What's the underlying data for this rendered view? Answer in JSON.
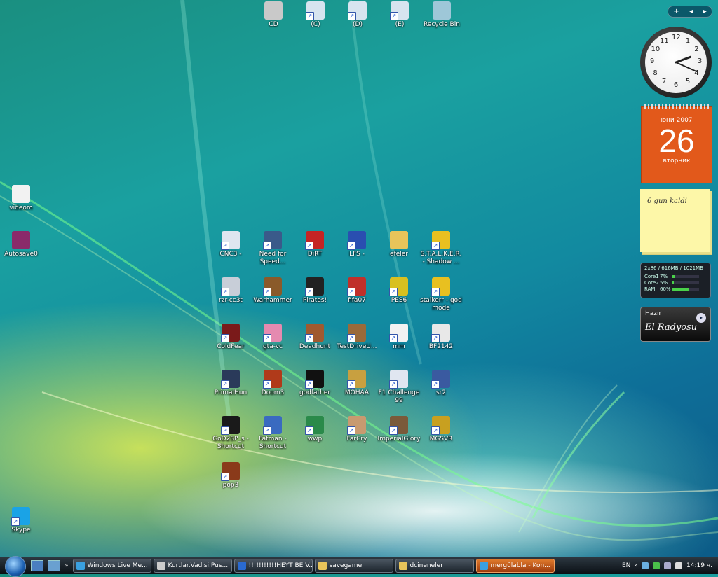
{
  "desktop": {
    "icons_top": [
      {
        "label": "CD",
        "icon": "cd-drive-icon",
        "color": "#c9c9c9"
      },
      {
        "label": "(C)",
        "icon": "drive-c-icon",
        "color": "#d7e4ef"
      },
      {
        "label": "(D)",
        "icon": "drive-d-icon",
        "color": "#d7e4ef"
      },
      {
        "label": "(E)",
        "icon": "drive-e-icon",
        "color": "#d7e4ef"
      },
      {
        "label": "Recycle Bin",
        "icon": "recycle-bin-icon",
        "color": "#9ec7d8"
      }
    ],
    "icons_left": [
      {
        "label": "videom",
        "icon": "video-file-icon",
        "color": "#f2f2f2"
      },
      {
        "label": "Autosave0",
        "icon": "winrar-archive-icon",
        "color": "#8a2a6a"
      },
      {
        "label": "Skype",
        "icon": "skype-icon",
        "color": "#1aa3e6"
      }
    ],
    "grid_rows": [
      [
        {
          "label": "CNC3 -",
          "icon": "cnc3-icon",
          "color": "#dfe6f0"
        },
        {
          "label": "Need for Speed...",
          "icon": "nfs-icon",
          "color": "#3a5a8a"
        },
        {
          "label": "DiRT",
          "icon": "dirt-icon",
          "color": "#c52424"
        },
        {
          "label": "LFS -",
          "icon": "lfs-icon",
          "color": "#2a4fb0"
        },
        {
          "label": "efeler",
          "icon": "folder-icon",
          "color": "#e8c45a"
        },
        {
          "label": "S.T.A.L.K.E.R. - Shadow ...",
          "icon": "stalker-icon",
          "color": "#e8c020"
        }
      ],
      [
        {
          "label": "rzr-cc3t",
          "icon": "rzr-icon",
          "color": "#c8ced8"
        },
        {
          "label": "Warhammer",
          "icon": "warhammer-icon",
          "color": "#8a5a2a"
        },
        {
          "label": "Pirates!",
          "icon": "pirates-icon",
          "color": "#222222"
        },
        {
          "label": "fifa07",
          "icon": "fifa-icon",
          "color": "#c0302a"
        },
        {
          "label": "PES6",
          "icon": "pes-icon",
          "color": "#d8c020"
        },
        {
          "label": "stalkerr - god mode",
          "icon": "stalker-icon",
          "color": "#e8c020"
        }
      ],
      [
        {
          "label": "ColdFear",
          "icon": "coldfear-icon",
          "color": "#7a1a1a"
        },
        {
          "label": "gta-vc",
          "icon": "gta-icon",
          "color": "#e58ab0"
        },
        {
          "label": "Deadhunt",
          "icon": "deadhunt-icon",
          "color": "#a05a30"
        },
        {
          "label": "TestDriveU...",
          "icon": "testdrive-icon",
          "color": "#9a6a3a"
        },
        {
          "label": "mm",
          "icon": "mm-icon",
          "color": "#f2f2f2"
        },
        {
          "label": "BF2142",
          "icon": "bf2142-icon",
          "color": "#e8e8e8"
        }
      ],
      [
        {
          "label": "PrimalHun",
          "icon": "primalhunt-icon",
          "color": "#2a3a5a"
        },
        {
          "label": "Doom3",
          "icon": "doom3-icon",
          "color": "#b03a1a"
        },
        {
          "label": "godfather",
          "icon": "godfather-icon",
          "color": "#111111"
        },
        {
          "label": "MOHAA",
          "icon": "mohaa-icon",
          "color": "#c8a040"
        },
        {
          "label": "F1 Challenge 99",
          "icon": "f1-icon",
          "color": "#e0e6f0"
        },
        {
          "label": "sr2",
          "icon": "sr2-icon",
          "color": "#3a5aa0"
        }
      ],
      [
        {
          "label": "GoD2SP_s - Shortcut",
          "icon": "godsp-icon",
          "color": "#1a1a1a"
        },
        {
          "label": "Fatman - Shortcut",
          "icon": "fatman-icon",
          "color": "#3a6ac0"
        },
        {
          "label": "wwp",
          "icon": "globe-icon",
          "color": "#2a8a4a"
        },
        {
          "label": "FarCry",
          "icon": "farcry-icon",
          "color": "#c89a70"
        },
        {
          "label": "ImperialGlory",
          "icon": "imperialglory-icon",
          "color": "#7a5a3a"
        },
        {
          "label": "MGSVR",
          "icon": "mgsvr-icon",
          "color": "#c8a020"
        }
      ],
      [
        {
          "label": "pop3",
          "icon": "pop3-icon",
          "color": "#8a3a1a"
        }
      ]
    ]
  },
  "sidebar": {
    "controls": {
      "add": "+",
      "prev": "◂",
      "next": "▸"
    },
    "clock": {
      "numbers": [
        "12",
        "1",
        "2",
        "3",
        "4",
        "5",
        "6",
        "7",
        "8",
        "9",
        "10",
        "11"
      ],
      "hour": 2,
      "minute": 19
    },
    "calendar": {
      "month_year": "юни 2007",
      "day": "26",
      "weekday": "вторник"
    },
    "note": {
      "text": "6 gun kaldi"
    },
    "meter": {
      "header": "2x86 / 616MB / 1021MB",
      "rows": [
        {
          "label": "Core1",
          "pct": "7%",
          "value": 0.07
        },
        {
          "label": "Core2",
          "pct": "5%",
          "value": 0.05
        },
        {
          "label": "RAM",
          "pct": "60%",
          "value": 0.6
        }
      ]
    },
    "radio": {
      "status": "Hazır",
      "station": "El Radyosu"
    }
  },
  "taskbar": {
    "quicklaunch_more": "»",
    "tasks": [
      {
        "label": "Windows Live Me...",
        "icon": "messenger-icon",
        "color": "#3aa0e0",
        "active": false
      },
      {
        "label": "Kurtlar.Vadisi.Pus...",
        "icon": "film-icon",
        "color": "#cccccc",
        "active": false
      },
      {
        "label": "!!!!!!!!!!!HEYT BE V...",
        "icon": "ie-icon",
        "color": "#2a6ad0",
        "active": false
      },
      {
        "label": "savegame",
        "icon": "folder-icon",
        "color": "#e8c45a",
        "active": false
      },
      {
        "label": "dcineneler",
        "icon": "folder-icon",
        "color": "#e8c45a",
        "active": false
      },
      {
        "label": "mergülabla - Kon...",
        "icon": "messenger-icon",
        "color": "#3aa0e0",
        "active": true
      }
    ],
    "tray": {
      "lang": "EN",
      "chevron": "‹",
      "time": "14:19 ч."
    }
  }
}
